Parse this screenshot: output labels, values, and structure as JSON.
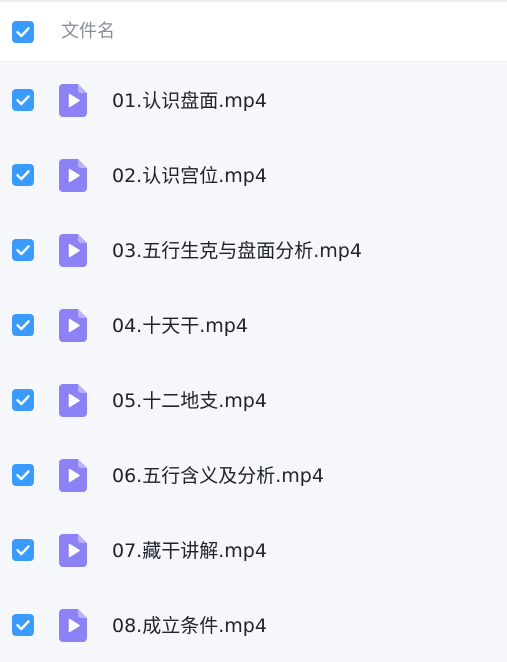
{
  "header": {
    "column_label": "文件名",
    "select_all_checked": true
  },
  "colors": {
    "checkbox": "#3a9bff",
    "file_icon": "#8c82f5",
    "background": "#f6f7fb"
  },
  "icons": {
    "checkbox": "checkbox-checked-icon",
    "file": "video-file-icon"
  },
  "files": [
    {
      "name": "01.认识盘面.mp4",
      "checked": true
    },
    {
      "name": "02.认识宫位.mp4",
      "checked": true
    },
    {
      "name": "03.五行生克与盘面分析.mp4",
      "checked": true
    },
    {
      "name": "04.十天干.mp4",
      "checked": true
    },
    {
      "name": "05.十二地支.mp4",
      "checked": true
    },
    {
      "name": "06.五行含义及分析.mp4",
      "checked": true
    },
    {
      "name": "07.藏干讲解.mp4",
      "checked": true
    },
    {
      "name": "08.成立条件.mp4",
      "checked": true
    }
  ]
}
